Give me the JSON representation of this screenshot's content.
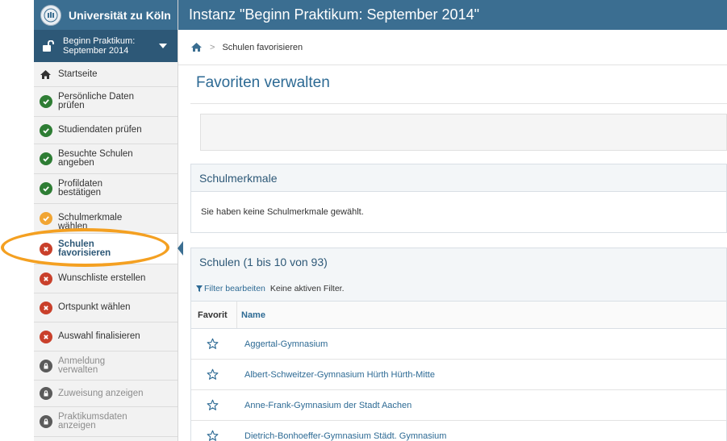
{
  "brand": {
    "name": "Universität zu Köln"
  },
  "instance": {
    "label_line1": "Beginn Praktikum:",
    "label_line2": "September 2014"
  },
  "header": {
    "title": "Instanz \"Beginn Praktikum: September 2014\""
  },
  "breadcrumb": {
    "current": "Schulen favorisieren",
    "separator": ">"
  },
  "page": {
    "title": "Favoriten verwalten"
  },
  "sidebar": {
    "items": [
      {
        "line1": "Startseite",
        "line2": "",
        "status": "home"
      },
      {
        "line1": "Persönliche Daten",
        "line2": "prüfen",
        "status": "done"
      },
      {
        "line1": "Studiendaten prüfen",
        "line2": "",
        "status": "done"
      },
      {
        "line1": "Besuchte Schulen",
        "line2": "angeben",
        "status": "done"
      },
      {
        "line1": "Profildaten",
        "line2": "bestätigen",
        "status": "done"
      },
      {
        "line1": "Schulmerkmale",
        "line2": "wählen",
        "status": "partial"
      },
      {
        "line1": "Schulen",
        "line2": "favorisieren",
        "status": "open",
        "active": true
      },
      {
        "line1": "Wunschliste erstellen",
        "line2": "",
        "status": "open"
      },
      {
        "line1": "Ortspunkt wählen",
        "line2": "",
        "status": "open"
      },
      {
        "line1": "Auswahl finalisieren",
        "line2": "",
        "status": "open"
      },
      {
        "line1": "Anmeldung",
        "line2": "verwalten",
        "status": "locked"
      },
      {
        "line1": "Zuweisung anzeigen",
        "line2": "",
        "status": "locked"
      },
      {
        "line1": "Praktikumsdaten",
        "line2": "anzeigen",
        "status": "locked"
      }
    ]
  },
  "criteria_panel": {
    "title": "Schulmerkmale",
    "message": "Sie haben keine Schulmerkmale gewählt."
  },
  "schools_panel": {
    "title": "Schulen (1 bis 10 von 93)",
    "filter_link": "Filter bearbeiten",
    "filter_status": "Keine aktiven Filter.",
    "columns": {
      "favorite": "Favorit",
      "name": "Name"
    },
    "rows": [
      {
        "name": "Aggertal-Gymnasium",
        "favorite": false
      },
      {
        "name": "Albert-Schweitzer-Gymnasium Hürth Hürth-Mitte",
        "favorite": false
      },
      {
        "name": "Anne-Frank-Gymnasium der Stadt Aachen",
        "favorite": false
      },
      {
        "name": "Dietrich-Bonhoeffer-Gymnasium Städt. Gymnasium",
        "favorite": false
      }
    ]
  },
  "colors": {
    "primary": "#3b6e91",
    "primary_dark": "#2d5877",
    "done": "#2e7d34",
    "partial": "#f1a533",
    "open": "#c9402b",
    "locked": "#5b5b5b",
    "highlight": "#f4a021"
  }
}
